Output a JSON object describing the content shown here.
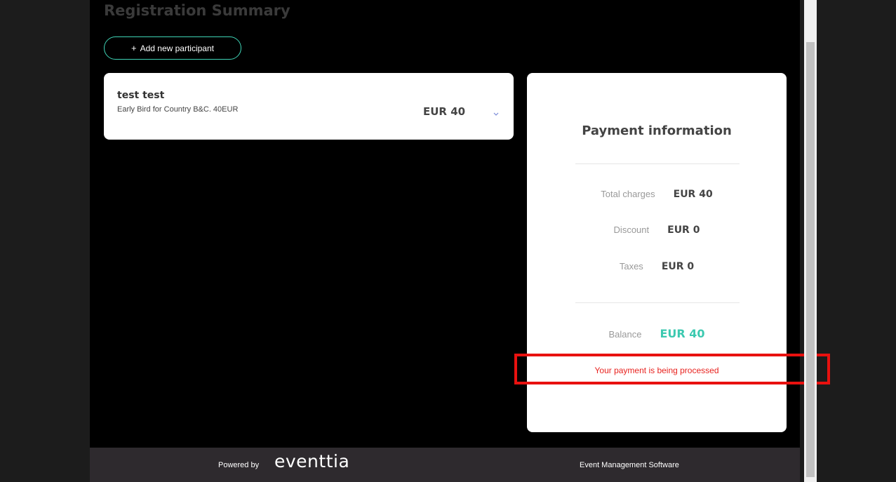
{
  "header": {
    "title": "Registration Summary",
    "add_participant_label": "Add new participant",
    "add_participant_icon": "plus-icon"
  },
  "participants": [
    {
      "name": "test test",
      "ticket": "Early Bird for Country B&C. 40EUR",
      "price": "EUR 40",
      "expand_icon": "chevron-down-icon"
    }
  ],
  "payment": {
    "title": "Payment information",
    "total_charges_label": "Total charges",
    "total_charges_value": "EUR 40",
    "discount_label": "Discount",
    "discount_value": "EUR 0",
    "taxes_label": "Taxes",
    "taxes_value": "EUR 0",
    "balance_label": "Balance",
    "balance_value": "EUR 40",
    "status_message": "Your payment is being processed"
  },
  "footer": {
    "powered_by": "Powered by",
    "logo_text": "eventtia",
    "tagline": "Event Management Software"
  },
  "colors": {
    "accent": "#3fd4b6",
    "balance": "#3cc9b0",
    "error": "#e8231f",
    "highlight": "#e8110f"
  }
}
